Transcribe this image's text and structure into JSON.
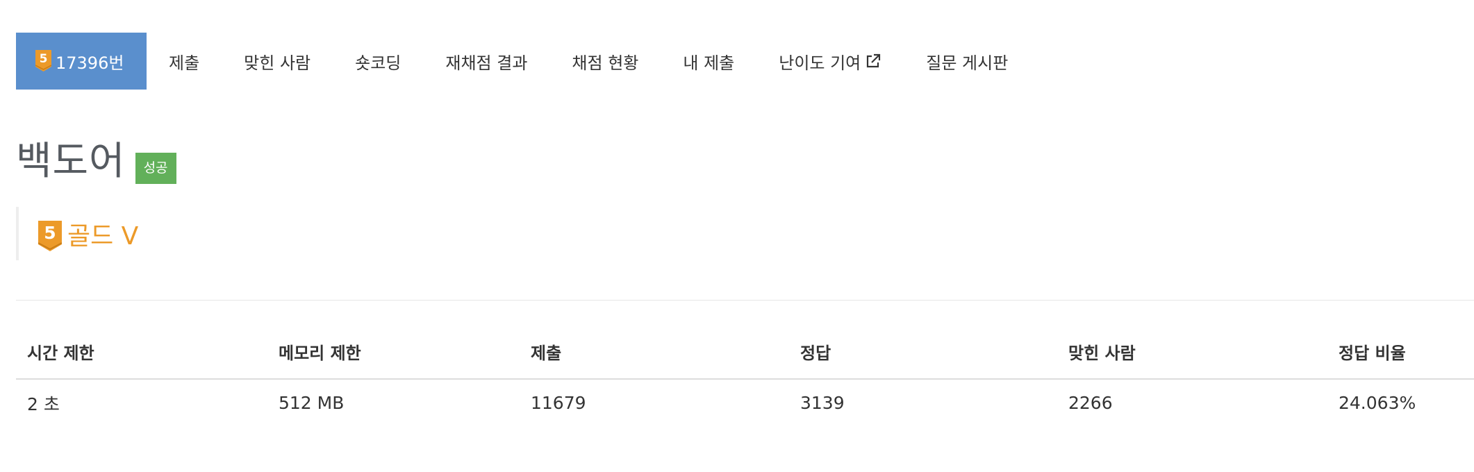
{
  "nav": {
    "active": {
      "tier_number": "5",
      "label": "17396번"
    },
    "tabs": [
      {
        "label": "제출",
        "name": "tab-submit"
      },
      {
        "label": "맞힌 사람",
        "name": "tab-solved-users"
      },
      {
        "label": "숏코딩",
        "name": "tab-short-coding"
      },
      {
        "label": "재채점 결과",
        "name": "tab-rejudge-result"
      },
      {
        "label": "채점 현황",
        "name": "tab-judge-status"
      },
      {
        "label": "내 제출",
        "name": "tab-my-submissions"
      },
      {
        "label": "난이도 기여",
        "name": "tab-difficulty-contribution",
        "external": true
      },
      {
        "label": "질문 게시판",
        "name": "tab-question-board"
      }
    ],
    "icons": {
      "tier": "tier-gold-5-icon",
      "external": "external-link-icon"
    }
  },
  "problem": {
    "title": "백도어",
    "status": "성공",
    "tier_number": "5",
    "tier_label": "골드 V"
  },
  "colors": {
    "active_tab_bg": "#5a8fcd",
    "success_badge": "#62b05a",
    "gold_tier": "#ec9a29"
  },
  "info_table": {
    "headers": [
      "시간 제한",
      "메모리 제한",
      "제출",
      "정답",
      "맞힌 사람",
      "정답 비율"
    ],
    "row": [
      "2 초",
      "512 MB",
      "11679",
      "3139",
      "2266",
      "24.063%"
    ]
  }
}
